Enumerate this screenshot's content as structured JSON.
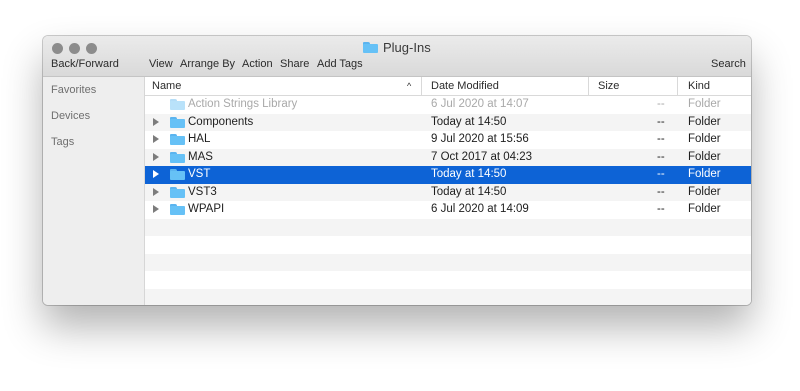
{
  "window": {
    "title": "Plug-Ins"
  },
  "toolbar": {
    "back_forward": "Back/Forward",
    "view": "View",
    "arrange_by": "Arrange By",
    "action": "Action",
    "share": "Share",
    "add_tags": "Add Tags",
    "search": "Search"
  },
  "sidebar": {
    "sections": [
      {
        "label": "Favorites"
      },
      {
        "label": "Devices"
      },
      {
        "label": "Tags"
      }
    ]
  },
  "columns": {
    "name": "Name",
    "date_modified": "Date Modified",
    "size": "Size",
    "kind": "Kind",
    "sort_indicator": "^"
  },
  "files": [
    {
      "name": "Action Strings Library",
      "date": "6 Jul 2020 at 14:07",
      "size": "--",
      "kind": "Folder",
      "state": "dimmed",
      "expandable": false
    },
    {
      "name": "Components",
      "date": "Today at 14:50",
      "size": "--",
      "kind": "Folder",
      "state": "normal",
      "expandable": true
    },
    {
      "name": "HAL",
      "date": "9 Jul 2020 at 15:56",
      "size": "--",
      "kind": "Folder",
      "state": "normal",
      "expandable": true
    },
    {
      "name": "MAS",
      "date": "7 Oct 2017 at 04:23",
      "size": "--",
      "kind": "Folder",
      "state": "normal",
      "expandable": true
    },
    {
      "name": "VST",
      "date": "Today at 14:50",
      "size": "--",
      "kind": "Folder",
      "state": "selected",
      "expandable": true
    },
    {
      "name": "VST3",
      "date": "Today at 14:50",
      "size": "--",
      "kind": "Folder",
      "state": "normal",
      "expandable": true
    },
    {
      "name": "WPAPI",
      "date": "6 Jul 2020 at 14:09",
      "size": "--",
      "kind": "Folder",
      "state": "normal",
      "expandable": true
    }
  ],
  "colors": {
    "selection": "#0d63d6",
    "folder": "#66c1f6"
  }
}
